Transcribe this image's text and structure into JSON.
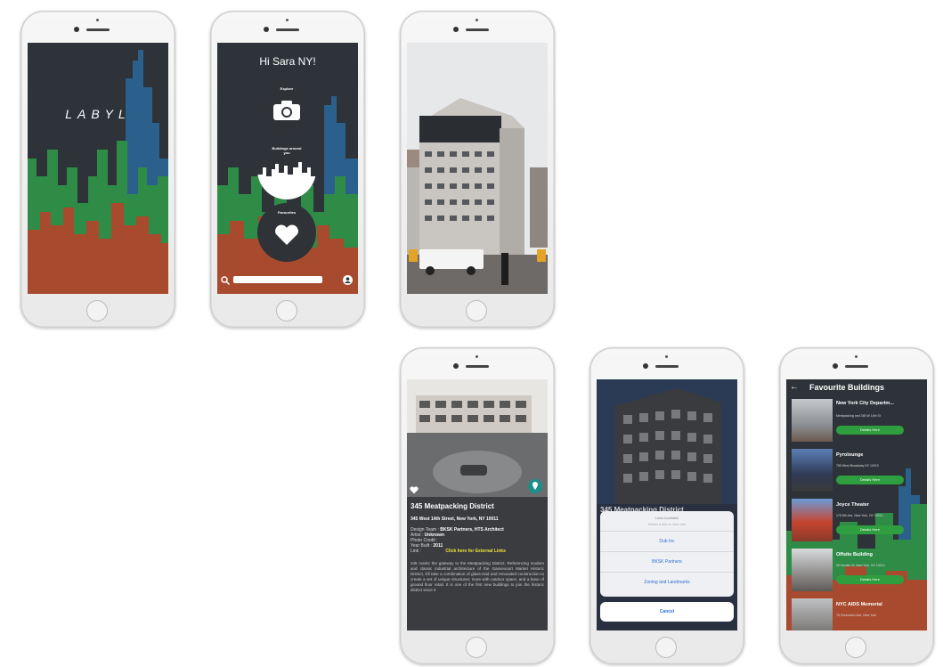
{
  "splash": {
    "logo": "LABYL"
  },
  "home": {
    "greeting": "Hi Sara NY!",
    "explore_label": "Explore",
    "buildings_label": "Buildings around you",
    "favourites_label": "Favourites",
    "search_placeholder": ""
  },
  "detail": {
    "title": "345 Meatpacking District",
    "address": "345 West 14th Street, New York, NY 10011",
    "fields": [
      {
        "label": "Design Team :",
        "value": "BKSK Partners, HTS Architect"
      },
      {
        "label": "Artist :",
        "value": "Unknown"
      },
      {
        "label": "Photo Credit :",
        "value": ""
      },
      {
        "label": "Year Built :",
        "value": "2011"
      }
    ],
    "link_label": "Link :",
    "link_text": "Click here for External Links",
    "description": "345 marks the gateway to the Meatpacking District. Referencing modern and classic industrial architecture of the Gansevoort Market Historic District, it'll take a combination of glass-clad and renovated construction to create a set of unique structures; more with outdoor space, and a base of ground floor retail. It is one of the first new buildings to join the historic district since it"
  },
  "sheet": {
    "title": "Links Available",
    "subtitle": "Select a link to view info",
    "options": [
      "Dub Inc",
      "BKSK Partners",
      "Zoning and Landmarks"
    ],
    "cancel": "Cancel",
    "background_title": "345 Meatpacking District"
  },
  "favourites": {
    "title": "Favourite Buildings",
    "action_label": "Details Here",
    "items": [
      {
        "name": "New York City Departm...",
        "address": "Meatpacking and 345 W 14th St"
      },
      {
        "name": "Pyrolounge",
        "address": "755 West Broadway NY 10013"
      },
      {
        "name": "Joyce Theater",
        "address": "175 8th Ave, New York, NY 10011"
      },
      {
        "name": "Offsite Building",
        "address": "95 Horatio St, New York, NY 10014"
      },
      {
        "name": "NYC AIDS Memorial",
        "address": "76 Greenwich Ave, New York"
      }
    ]
  },
  "colors": {
    "skyline_dark": "#2d3338",
    "skyline_blue": "#2b5f8c",
    "skyline_green": "#2f8c47",
    "skyline_red": "#a84a2e",
    "accent_green": "#2e9e3e",
    "link_yellow": "#f2e23a",
    "link_blue": "#2d6fd6"
  }
}
